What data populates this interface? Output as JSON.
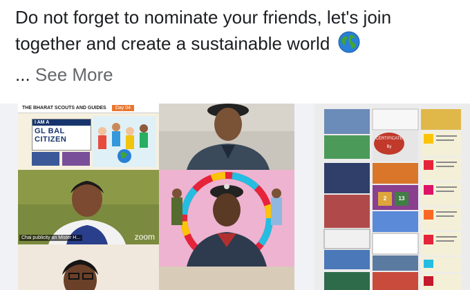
{
  "post": {
    "line1": "Do not forget to nominate your friends, let's join",
    "line2": "together and create a sustainable world",
    "ellipsis": "...",
    "see_more_label": "See More"
  },
  "icons": {
    "globe": "globe-emoji-icon"
  },
  "photo1": {
    "banner_text": "THE BHARAT SCOUTS AND GUIDES",
    "day_tag": "Day 04",
    "gc_top": "I AM A",
    "gc_main": "GL BAL CITIZEN",
    "name_label": "Chai publicity an Mister H...",
    "zoom_label": "zoom"
  },
  "photo2": {
    "certificate_title": "CERTIFICATE",
    "certificate_by": "By",
    "sdg_number": "2",
    "sdg_number_b": "13"
  },
  "colors": {
    "text": "#1c1e21",
    "secondary_text": "#65676b",
    "uniform_navy": "#2e3b4e"
  }
}
